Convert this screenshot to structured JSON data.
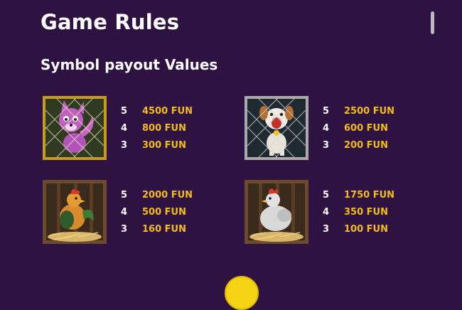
{
  "page": {
    "title": "Game Rules",
    "section_title": "Symbol payout Values"
  },
  "symbols": [
    {
      "name": "Fox",
      "icon": "fox-icon",
      "frame": "gold-cage",
      "payouts": [
        {
          "count": "5",
          "value": "4500 FUN"
        },
        {
          "count": "4",
          "value": "800 FUN"
        },
        {
          "count": "3",
          "value": "300 FUN"
        }
      ]
    },
    {
      "name": "Dog",
      "icon": "dog-icon",
      "frame": "silver-cage",
      "payouts": [
        {
          "count": "5",
          "value": "2500 FUN"
        },
        {
          "count": "4",
          "value": "600 FUN"
        },
        {
          "count": "3",
          "value": "200 FUN"
        }
      ]
    },
    {
      "name": "Rooster",
      "icon": "rooster-icon",
      "frame": "wooden-coop",
      "payouts": [
        {
          "count": "5",
          "value": "2000 FUN"
        },
        {
          "count": "4",
          "value": "500 FUN"
        },
        {
          "count": "3",
          "value": "160 FUN"
        }
      ]
    },
    {
      "name": "Hen",
      "icon": "hen-icon",
      "frame": "wooden-coop",
      "payouts": [
        {
          "count": "5",
          "value": "1750 FUN"
        },
        {
          "count": "4",
          "value": "350 FUN"
        },
        {
          "count": "3",
          "value": "100 FUN"
        }
      ]
    }
  ],
  "colors": {
    "background": "#2e1242",
    "payout_value": "#f2bd1c",
    "count": "#ffffff",
    "coin": "#f5d415"
  }
}
